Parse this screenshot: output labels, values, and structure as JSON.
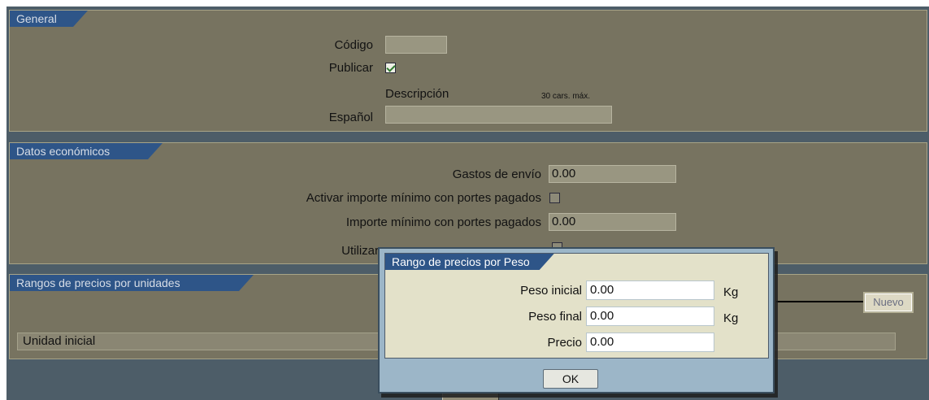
{
  "general": {
    "section_title": "General",
    "codigo_label": "Código",
    "codigo_value": "",
    "publicar_label": "Publicar",
    "publicar_checked": true,
    "descripcion_header": "Descripción",
    "max_chars_note": "30 cars. máx.",
    "espanol_label": "Español",
    "espanol_value": ""
  },
  "datos_economicos": {
    "section_title": "Datos económicos",
    "gastos_envio_label": "Gastos de envío",
    "gastos_envio_value": "0.00",
    "activar_importe_label": "Activar importe mínimo con portes pagados",
    "activar_importe_checked": false,
    "importe_minimo_label": "Importe mínimo con portes pagados",
    "importe_minimo_value": "0.00",
    "utilizar_label": "Utilizar"
  },
  "rangos_unidades": {
    "section_title": "Rangos de precios por unidades",
    "column_header": "Unidad inicial",
    "nuevo_button": "Nuevo"
  },
  "dialog": {
    "title": "Rango de precios por Peso",
    "peso_inicial_label": "Peso inicial",
    "peso_inicial_value": "0.00",
    "peso_inicial_unit": "Kg",
    "peso_final_label": "Peso final",
    "peso_final_value": "0.00",
    "peso_final_unit": "Kg",
    "precio_label": "Precio",
    "precio_value": "0.00",
    "ok_button": "OK"
  },
  "colors": {
    "backdrop": "#4d5d68",
    "panel": "#777360",
    "tab": "#2e5588",
    "dialog_frame": "#9cb6c8",
    "dialog_body": "#e3e1c9"
  },
  "icons": [
    "checkbox-checked-icon",
    "checkbox-unchecked-icon"
  ]
}
